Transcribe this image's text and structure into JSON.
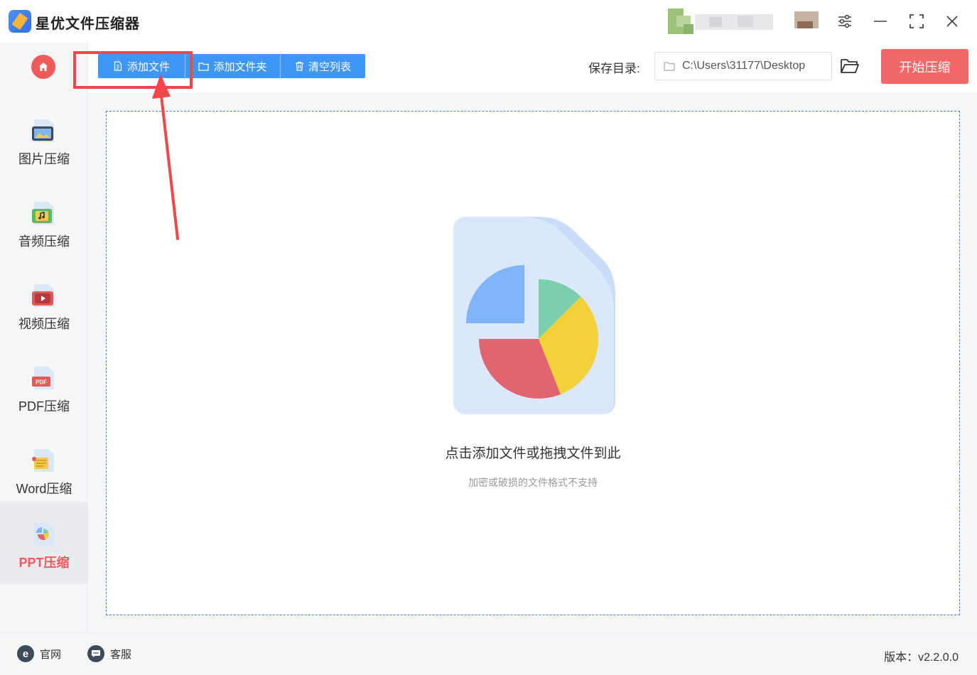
{
  "app": {
    "title": "星优文件压缩器"
  },
  "sidebar": {
    "items": [
      {
        "label": "图片压缩",
        "icon": "image-icon"
      },
      {
        "label": "音频压缩",
        "icon": "music-icon"
      },
      {
        "label": "视频压缩",
        "icon": "video-icon"
      },
      {
        "label": "PDF压缩",
        "icon": "pdf-icon"
      },
      {
        "label": "Word压缩",
        "icon": "word-icon"
      },
      {
        "label": "PPT压缩",
        "icon": "ppt-icon",
        "active": true
      }
    ]
  },
  "toolbar": {
    "add_file": "添加文件",
    "add_folder": "添加文件夹",
    "clear_list": "清空列表",
    "save_dir_label": "保存目录:",
    "save_dir_value": "C:\\Users\\31177\\Desktop",
    "start_button": "开始压缩"
  },
  "dropzone": {
    "title": "点击添加文件或拖拽文件到此",
    "subtitle": "加密或破损的文件格式不支持"
  },
  "footer": {
    "website": "官网",
    "support": "客服",
    "version": "版本：v2.2.0.0"
  },
  "colors": {
    "accent_blue": "#4096f5",
    "accent_red": "#f06868",
    "active_label": "#ee5b5b"
  }
}
